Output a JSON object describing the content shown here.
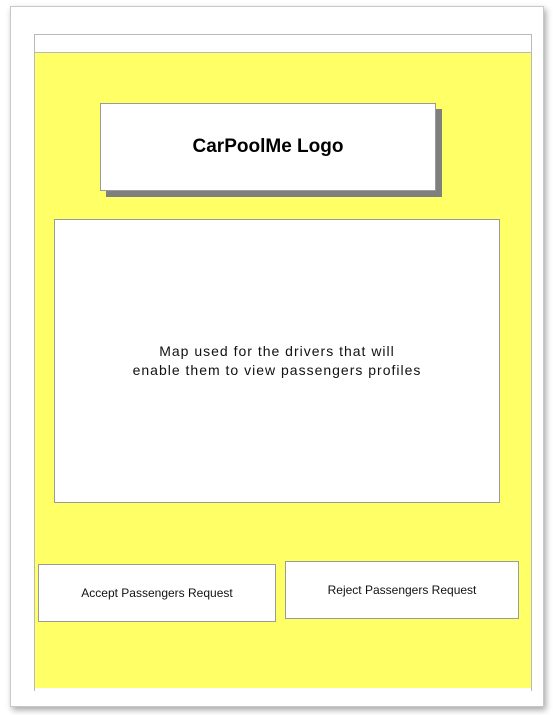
{
  "logo": {
    "text": "CarPoolMe Logo"
  },
  "map": {
    "line1": "Map used for the drivers that will",
    "line2": "enable them to view passengers profiles"
  },
  "actions": {
    "accept_label": "Accept Passengers Request",
    "reject_label": "Reject Passengers Request"
  },
  "colors": {
    "screen_background": "#ffff66",
    "box_background": "#ffffff",
    "logo_shadow": "#7f7f7f"
  }
}
